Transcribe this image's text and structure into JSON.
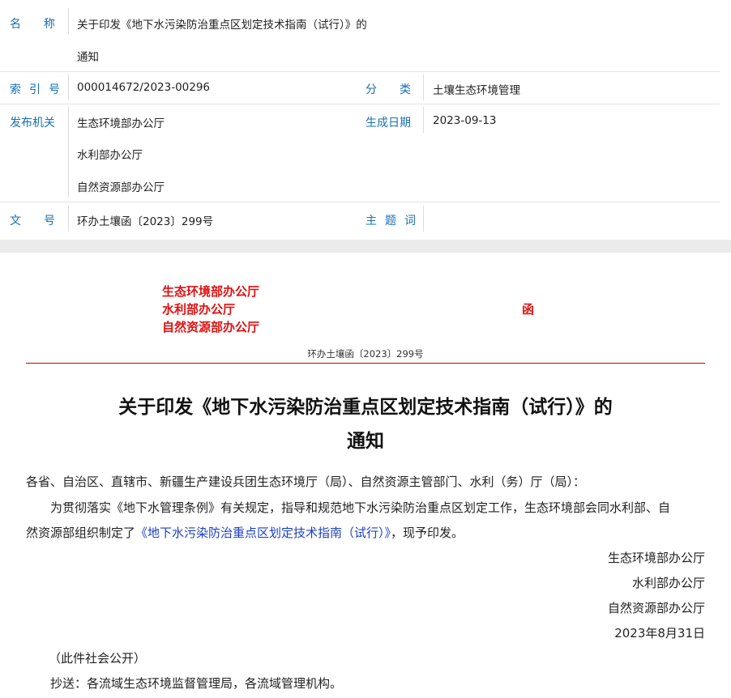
{
  "meta": {
    "name_label": "名称",
    "name_value_line1": "关于印发《地下水污染防治重点区划定技术指南（试行）》的",
    "name_value_line2": "通知",
    "index_label": "索引号",
    "index_value": "000014672/2023-00296",
    "category_label": "分类",
    "category_value": "土壤生态环境管理",
    "issuer_label": "发布机关",
    "issuers": [
      "生态环境部办公厅",
      "水利部办公厅",
      "自然资源部办公厅"
    ],
    "date_label": "生成日期",
    "date_value": "2023-09-13",
    "docnum_label": "文号",
    "docnum_value": "环办土壤函〔2023〕299号",
    "subject_label": "主题词",
    "subject_value": ""
  },
  "doc": {
    "header_orgs": [
      "生态环境部办公厅",
      "水利部办公厅",
      "自然资源部办公厅"
    ],
    "header_type": "函",
    "doc_number": "环办土壤函〔2023〕299号",
    "title_line1": "关于印发《地下水污染防治重点区划定技术指南（试行）》的",
    "title_line2": "通知",
    "salutation": "各省、自治区、直辖市、新疆生产建设兵团生态环境厅（局）、自然资源主管部门、水利（务）厅（局）：",
    "body_line1": "为贯彻落实《地下水管理条例》有关规定，指导和规范地下水污染防治重点区划定工作，生态环境部会同水利部、自",
    "body_line2_pre": "然资源部组织制定了",
    "body_link": "《地下水污染防治重点区划定技术指南（试行）》",
    "body_line2_post": "，现予印发。",
    "signatures": [
      "生态环境部办公厅",
      "水利部办公厅",
      "自然资源部办公厅"
    ],
    "date": "2023年8月31日",
    "public_note": "（此件社会公开）",
    "cc": "抄送：各流域生态环境监督管理局，各流域管理机构。"
  }
}
